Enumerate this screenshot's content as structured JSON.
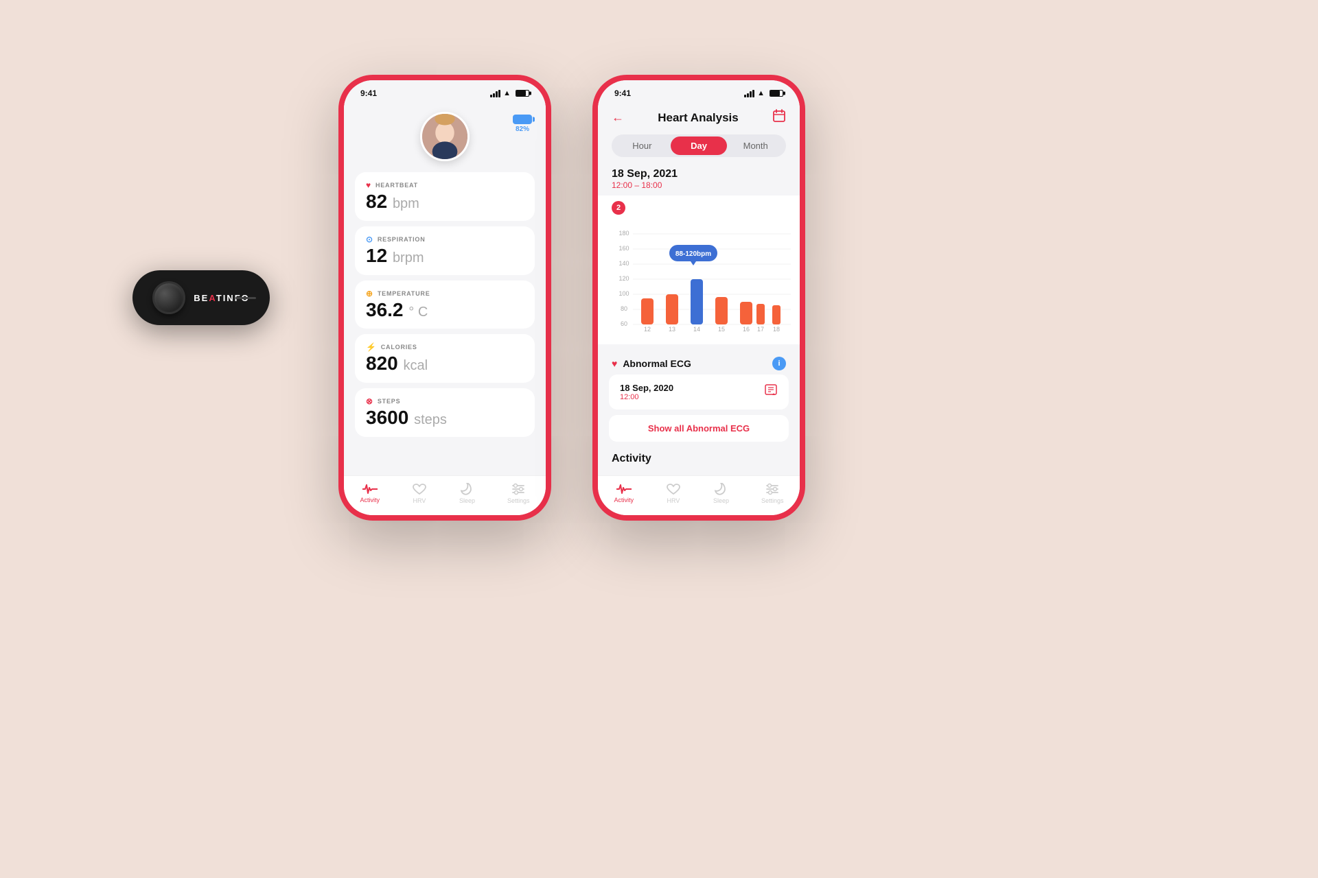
{
  "background": "#f0e0d8",
  "device": {
    "label": "BE",
    "label_a": "A",
    "label_b": "TINFO",
    "brand": "BEATINFO"
  },
  "phone1": {
    "status_time": "9:41",
    "battery_percent": "82%",
    "profile_battery_color": "#4a9af5",
    "metrics": [
      {
        "icon": "♥",
        "icon_color": "red",
        "label": "HEARTBEAT",
        "value": "82",
        "unit": "bpm"
      },
      {
        "icon": "🫁",
        "icon_color": "blue",
        "label": "RESPIRATION",
        "value": "12",
        "unit": "brpm"
      },
      {
        "icon": "🌡",
        "icon_color": "orange",
        "label": "TEMPERATURE",
        "value": "36.2",
        "unit": "° C"
      },
      {
        "icon": "⚡",
        "icon_color": "orange",
        "label": "CALORIES",
        "value": "820",
        "unit": "kcal"
      },
      {
        "icon": "👣",
        "icon_color": "red",
        "label": "STEPS",
        "value": "3600",
        "unit": "steps"
      }
    ],
    "nav": [
      {
        "icon": "activity",
        "label": "Activity",
        "active": true
      },
      {
        "icon": "hrv",
        "label": "HRV",
        "active": false
      },
      {
        "icon": "sleep",
        "label": "Sleep",
        "active": false
      },
      {
        "icon": "settings",
        "label": "Settings",
        "active": false
      }
    ]
  },
  "phone2": {
    "status_time": "9:41",
    "title": "Heart Analysis",
    "time_options": [
      "Hour",
      "Day",
      "Month"
    ],
    "active_time": "Day",
    "date_main": "18 Sep, 2021",
    "date_range": "12:00 – 18:00",
    "chart_badge": "2",
    "chart_tooltip": "88-120bpm",
    "chart_y_labels": [
      60,
      80,
      100,
      120,
      140,
      160,
      180
    ],
    "chart_x_labels": [
      12,
      13,
      14,
      15,
      16,
      17,
      18
    ],
    "ecg_section_title": "Abnormal ECG",
    "ecg_date": "18 Sep, 2020",
    "ecg_time": "12:00",
    "show_all_label": "Show all Abnormal ECG",
    "activity_label": "Activity",
    "nav": [
      {
        "icon": "activity",
        "label": "Activity",
        "active": true
      },
      {
        "icon": "hrv",
        "label": "HRV",
        "active": false
      },
      {
        "icon": "sleep",
        "label": "Sleep",
        "active": false
      },
      {
        "icon": "settings",
        "label": "Settings",
        "active": false
      }
    ]
  }
}
